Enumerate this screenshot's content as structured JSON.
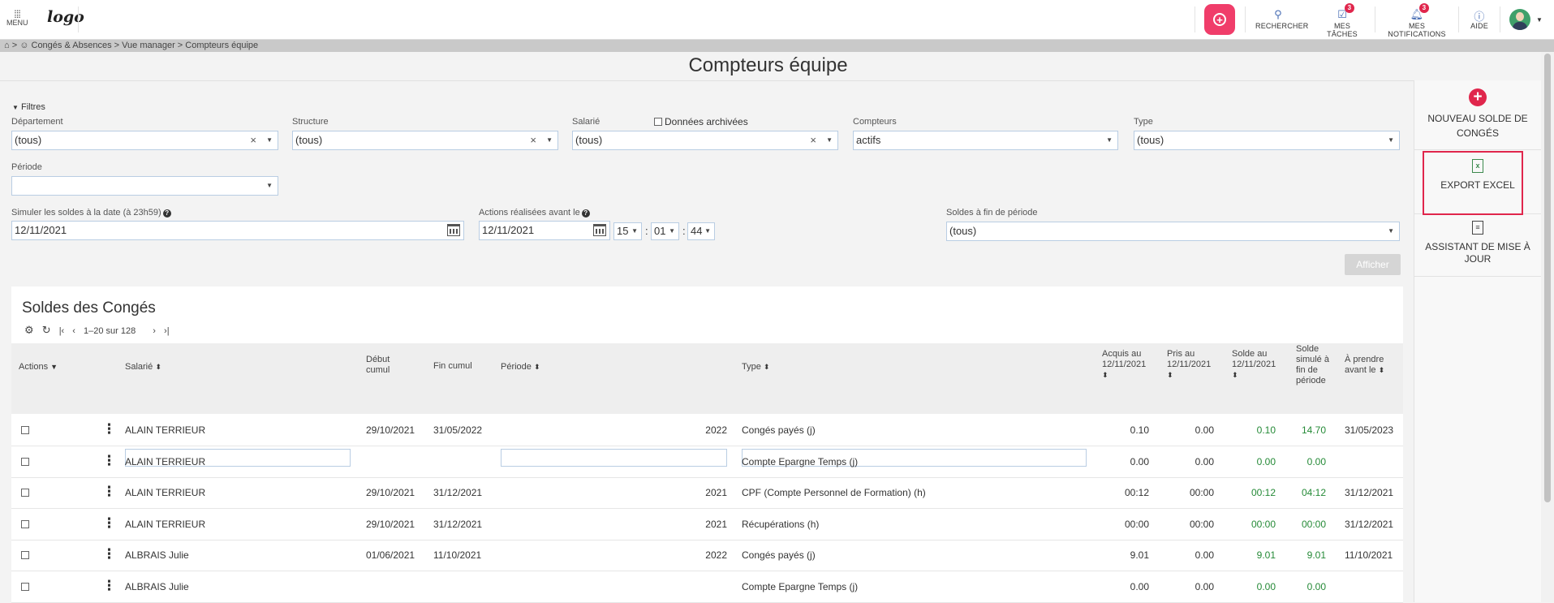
{
  "topbar": {
    "menu_label": "MENU",
    "logo_text": "logo",
    "search_label": "RECHERCHER",
    "tasks_label": "MES TÂCHES",
    "tasks_count": "3",
    "notifications_label": "MES NOTIFICATIONS",
    "notifications_count": "3",
    "help_label": "AIDE"
  },
  "breadcrumb": "Congés & Absences > Vue manager > Compteurs équipe",
  "page_title": "Compteurs équipe",
  "filters": {
    "toggle_label": "Filtres",
    "department_label": "Département",
    "department_value": "(tous)",
    "structure_label": "Structure",
    "structure_value": "(tous)",
    "employee_label": "Salarié",
    "archived_label": "Données archivées",
    "employee_value": "(tous)",
    "counters_label": "Compteurs",
    "counters_value": "actifs",
    "type_label": "Type",
    "type_value": "(tous)",
    "period_label": "Période",
    "period_value": "",
    "simulate_label": "Simuler les soldes à la date (à 23h59)",
    "simulate_value": "12/11/2021",
    "actions_label": "Actions réalisées avant le",
    "actions_date": "12/11/2021",
    "actions_hour": "15",
    "actions_min": "01",
    "actions_sec": "44",
    "end_balance_label": "Soldes à fin de période",
    "end_balance_value": "(tous)",
    "show_button": "Afficher"
  },
  "side_actions": {
    "new_balance": "NOUVEAU SOLDE DE CONGÉS",
    "export_excel": "EXPORT EXCEL",
    "update_assistant": "ASSISTANT DE MISE À JOUR"
  },
  "table": {
    "title": "Soldes des Congés",
    "pagination": "1–20 sur 128",
    "columns": {
      "actions": "Actions",
      "employee": "Salarié",
      "start": "Début cumul",
      "end": "Fin cumul",
      "period": "Période",
      "type": "Type",
      "acquired": "Acquis au 12/11/2021",
      "taken": "Pris au 12/11/2021",
      "balance": "Solde au 12/11/2021",
      "simulated": "Solde simulé à fin de période",
      "to_take": "À prendre avant le"
    },
    "rows": [
      {
        "employee": "ALAIN TERRIEUR",
        "start": "29/10/2021",
        "end": "31/05/2022",
        "period": "2022",
        "type": "Congés payés (j)",
        "acquired": "0.10",
        "taken": "0.00",
        "balance": "0.10",
        "simulated": "14.70",
        "to_take": "31/05/2023"
      },
      {
        "employee": "ALAIN TERRIEUR",
        "start": "",
        "end": "",
        "period": "",
        "type": "Compte Epargne Temps (j)",
        "acquired": "0.00",
        "taken": "0.00",
        "balance": "0.00",
        "simulated": "0.00",
        "to_take": ""
      },
      {
        "employee": "ALAIN TERRIEUR",
        "start": "29/10/2021",
        "end": "31/12/2021",
        "period": "2021",
        "type": "CPF (Compte Personnel de Formation) (h)",
        "acquired": "00:12",
        "taken": "00:00",
        "balance": "00:12",
        "simulated": "04:12",
        "to_take": "31/12/2021"
      },
      {
        "employee": "ALAIN TERRIEUR",
        "start": "29/10/2021",
        "end": "31/12/2021",
        "period": "2021",
        "type": "Récupérations (h)",
        "acquired": "00:00",
        "taken": "00:00",
        "balance": "00:00",
        "simulated": "00:00",
        "to_take": "31/12/2021"
      },
      {
        "employee": "ALBRAIS Julie",
        "start": "01/06/2021",
        "end": "11/10/2021",
        "period": "2022",
        "type": "Congés payés (j)",
        "acquired": "9.01",
        "taken": "0.00",
        "balance": "9.01",
        "simulated": "9.01",
        "to_take": "11/10/2021"
      },
      {
        "employee": "ALBRAIS Julie",
        "start": "",
        "end": "",
        "period": "",
        "type": "Compte Epargne Temps (j)",
        "acquired": "0.00",
        "taken": "0.00",
        "balance": "0.00",
        "simulated": "0.00",
        "to_take": ""
      }
    ]
  }
}
